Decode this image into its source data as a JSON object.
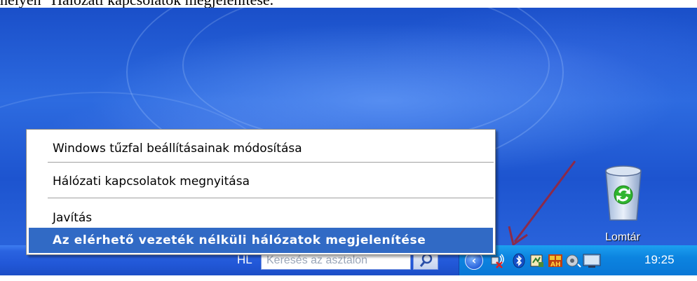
{
  "caption": "helyen \"Hálózati kapcsolatok megjelenítése.\"",
  "desktop": {
    "recycle_bin_label": "Lomtár"
  },
  "context_menu": {
    "items": [
      {
        "label": "Windows tűzfal beállításainak módosítása",
        "selected": false
      },
      {
        "label": "Hálózati kapcsolatok megnyitása",
        "selected": false
      },
      {
        "label": "Javítás",
        "selected": false
      },
      {
        "label": "Az elérhető vezeték nélküli hálózatok megjelenítése",
        "selected": true
      }
    ]
  },
  "taskbar": {
    "language": "HL",
    "search_placeholder": "Keresés az asztalon",
    "clock": "19:25",
    "tray_icons": [
      "show-hidden-icons-chevron",
      "wireless-network-disconnected-icon",
      "bluetooth-icon",
      "media-icon",
      "app-icon",
      "speaker-icon",
      "display-icon"
    ]
  },
  "colors": {
    "menu_highlight": "#316ac5",
    "taskbar_blue": "#2258d8",
    "tray_blue": "#0c84e0",
    "arrow": "#8b2a4a"
  }
}
